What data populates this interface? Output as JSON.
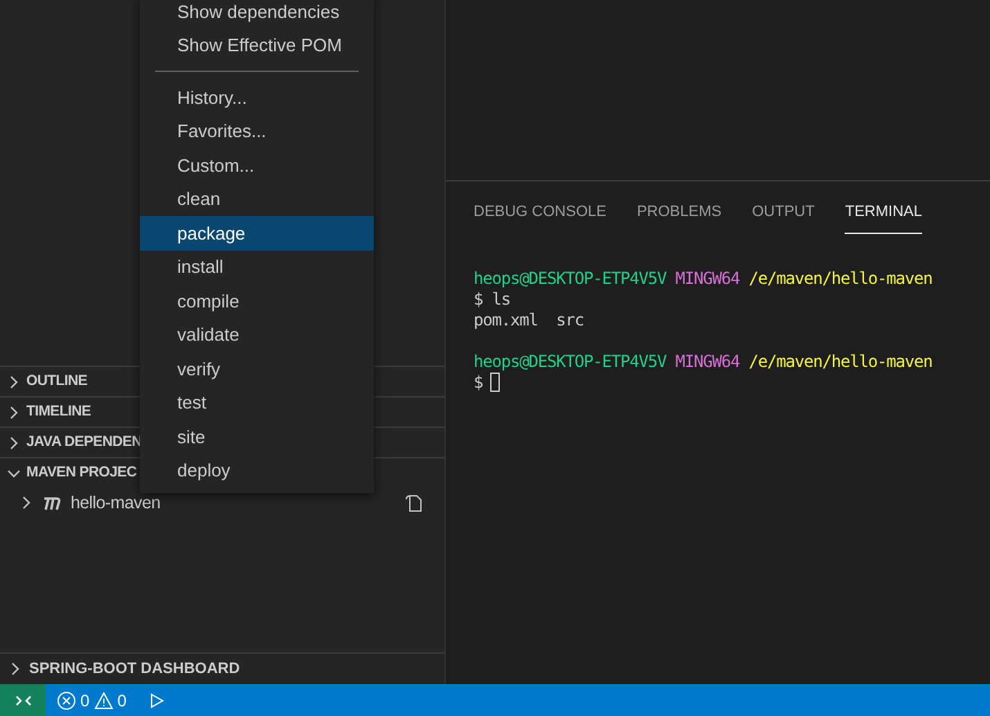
{
  "sidebar": {
    "sections": [
      {
        "title": "OUTLINE",
        "expanded": false
      },
      {
        "title": "TIMELINE",
        "expanded": false
      },
      {
        "title": "JAVA DEPENDEN",
        "expanded": false
      },
      {
        "title": "MAVEN PROJEC",
        "expanded": true,
        "items": [
          {
            "label": "hello-maven",
            "expanded": false
          }
        ]
      }
    ],
    "bottom_section": {
      "title": "SPRING-BOOT DASHBOARD",
      "expanded": false
    }
  },
  "context_menu": {
    "groups": [
      [
        {
          "label": "Show dependencies",
          "selected": false
        },
        {
          "label": "Show Effective POM",
          "selected": false
        }
      ],
      [
        {
          "label": "History...",
          "selected": false
        },
        {
          "label": "Favorites...",
          "selected": false
        },
        {
          "label": "Custom...",
          "selected": false
        },
        {
          "label": "clean",
          "selected": false
        },
        {
          "label": "package",
          "selected": true
        },
        {
          "label": "install",
          "selected": false
        },
        {
          "label": "compile",
          "selected": false
        },
        {
          "label": "validate",
          "selected": false
        },
        {
          "label": "verify",
          "selected": false
        },
        {
          "label": "test",
          "selected": false
        },
        {
          "label": "site",
          "selected": false
        },
        {
          "label": "deploy",
          "selected": false
        }
      ]
    ]
  },
  "panel": {
    "tabs": [
      {
        "label": "DEBUG CONSOLE",
        "selected": false
      },
      {
        "label": "PROBLEMS",
        "selected": false
      },
      {
        "label": "OUTPUT",
        "selected": false
      },
      {
        "label": "TERMINAL",
        "selected": true
      }
    ],
    "terminal": [
      {
        "kind": "prompt",
        "user": "heops@DESKTOP-ETP4V5V",
        "env": "MINGW64",
        "path": "/e/maven/hello-maven"
      },
      {
        "kind": "text",
        "text": "$ ls"
      },
      {
        "kind": "text",
        "text": "pom.xml  src"
      },
      {
        "kind": "blank"
      },
      {
        "kind": "prompt",
        "user": "heops@DESKTOP-ETP4V5V",
        "env": "MINGW64",
        "path": "/e/maven/hello-maven"
      },
      {
        "kind": "cursor",
        "text": "$"
      }
    ]
  },
  "status_bar": {
    "errors": "0",
    "warnings": "0"
  }
}
